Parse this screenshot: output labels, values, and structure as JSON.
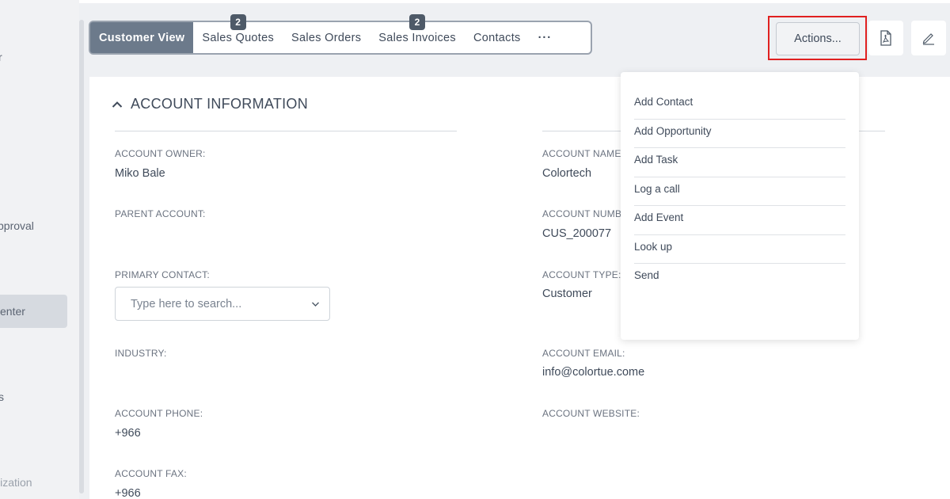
{
  "sidebar": {
    "items": [
      {
        "label": "r"
      },
      {
        "label": "pproval"
      },
      {
        "label": "enter"
      },
      {
        "label": "s"
      },
      {
        "label": "lization"
      }
    ]
  },
  "tabs": [
    {
      "label": "Customer View",
      "badge": ""
    },
    {
      "label": "Sales Quotes",
      "badge": "2"
    },
    {
      "label": "Sales Orders",
      "badge": ""
    },
    {
      "label": "Sales Invoices",
      "badge": "2"
    },
    {
      "label": "Contacts",
      "badge": ""
    },
    {
      "label": "···",
      "badge": ""
    }
  ],
  "toolbar": {
    "actions_label": "Actions...",
    "pdf_icon": "pdf-icon",
    "edit_icon": "pencil-icon"
  },
  "section": {
    "title": "ACCOUNT INFORMATION"
  },
  "fields": {
    "account_owner_label": "ACCOUNT OWNER:",
    "account_owner_value": "Miko Bale",
    "parent_account_label": "PARENT ACCOUNT:",
    "primary_contact_label": "PRIMARY CONTACT:",
    "primary_contact_placeholder": "Type here to search...",
    "industry_label": "INDUSTRY:",
    "account_phone_label": "ACCOUNT PHONE:",
    "account_phone_value": "+966",
    "account_fax_label": "ACCOUNT FAX:",
    "account_fax_value": "+966",
    "account_name_label": "ACCOUNT NAME:",
    "account_name_value": "Colortech",
    "account_number_label": "ACCOUNT NUMBER:",
    "account_number_value": "CUS_200077",
    "account_type_label": "ACCOUNT TYPE:",
    "account_type_value": "Customer",
    "account_email_label": "ACCOUNT EMAIL:",
    "account_email_value": "info@colortue.come",
    "account_website_label": "ACCOUNT WEBSITE:"
  },
  "menu": {
    "items": [
      {
        "label": "Add Contact"
      },
      {
        "label": "Add Opportunity"
      },
      {
        "label": "Add Task"
      },
      {
        "label": "Log a call"
      },
      {
        "label": "Add Event"
      },
      {
        "label": "Look up"
      },
      {
        "label": "Send"
      }
    ]
  },
  "colors": {
    "accent": "#6c7a8b",
    "highlight": "#e02020",
    "badge": "#4e5a68"
  }
}
